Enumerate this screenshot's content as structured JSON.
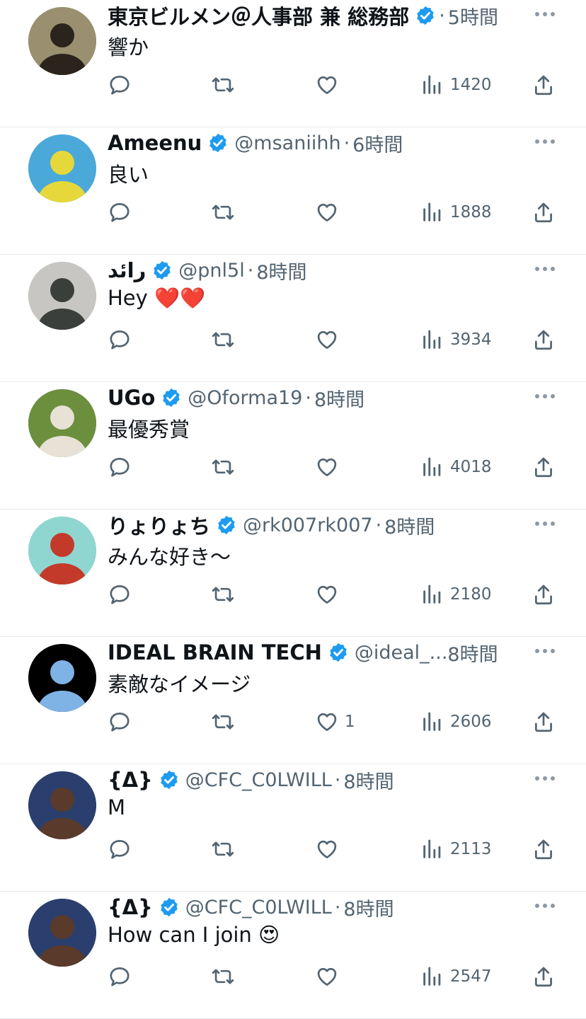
{
  "icons": {
    "reply": "reply-bubble-icon",
    "retweet": "retweet-icon",
    "like": "heart-icon",
    "views": "views-chart-icon",
    "share": "share-upload-icon",
    "verified": "verified-badge-icon",
    "more": "more-dots-icon"
  },
  "colors": {
    "text": "#0f1419",
    "secondary": "#536471",
    "verified": "#1d9bf0",
    "divider": "#e6e9ec"
  },
  "tweets": [
    {
      "name": "東京ビルメン＠人事部 兼 総務部",
      "handle": "",
      "dot": "·",
      "time": "5時間",
      "text": "響か",
      "likes": "",
      "views": "1420",
      "avatar": {
        "bg": "#9a8f6f",
        "accent": "#2a241c",
        "ring": "#5f6b45"
      }
    },
    {
      "name": "Ameenu",
      "handle": "@msaniihh",
      "dot": "·",
      "time": "6時間",
      "text": "良い",
      "likes": "",
      "views": "1888",
      "avatar": {
        "bg": "#4aa9d8",
        "accent": "#e6d83a",
        "ring": "#4aa9d8"
      }
    },
    {
      "name": "رائد",
      "handle": "@pnl5l",
      "dot": "·",
      "time": "8時間",
      "text": "Hey ❤️❤️",
      "likes": "",
      "views": "3934",
      "avatar": {
        "bg": "#c8c6c2",
        "accent": "#3a3f3c",
        "ring": "#9aa29d"
      }
    },
    {
      "name": "UGo",
      "handle": "@Oforma19",
      "dot": "·",
      "time": "8時間",
      "text": "最優秀賞",
      "likes": "",
      "views": "4018",
      "avatar": {
        "bg": "#6c8f3e",
        "accent": "#e8e2d6",
        "ring": "#4d6a2c"
      }
    },
    {
      "name": "りょりょち",
      "handle": "@rk007rk007",
      "dot": "·",
      "time": "8時間",
      "text": "みんな好き〜",
      "likes": "",
      "views": "2180",
      "avatar": {
        "bg": "#8fd6d1",
        "accent": "#c43a2a",
        "ring": "#6cc1bd"
      }
    },
    {
      "name": "IDEAL BRAIN TECH",
      "handle": "@ideal_...",
      "dot": "",
      "time": "8時間",
      "text": "素敵なイメージ",
      "likes": "1",
      "views": "2606",
      "avatar": {
        "bg": "#000000",
        "accent": "#7fb2e5",
        "ring": "#000000"
      }
    },
    {
      "name": "{Δ}",
      "handle": "@CFC_C0LWILL",
      "dot": "·",
      "time": "8時間",
      "text": "M",
      "likes": "",
      "views": "2113",
      "avatar": {
        "bg": "#2a3f6e",
        "accent": "#5a3a2a",
        "ring": "#1d2c4f"
      }
    },
    {
      "name": "{Δ}",
      "handle": "@CFC_C0LWILL",
      "dot": "·",
      "time": "8時間",
      "text": "How can I join 😍",
      "likes": "",
      "views": "2547",
      "avatar": {
        "bg": "#2a3f6e",
        "accent": "#5a3a2a",
        "ring": "#1d2c4f"
      }
    }
  ]
}
